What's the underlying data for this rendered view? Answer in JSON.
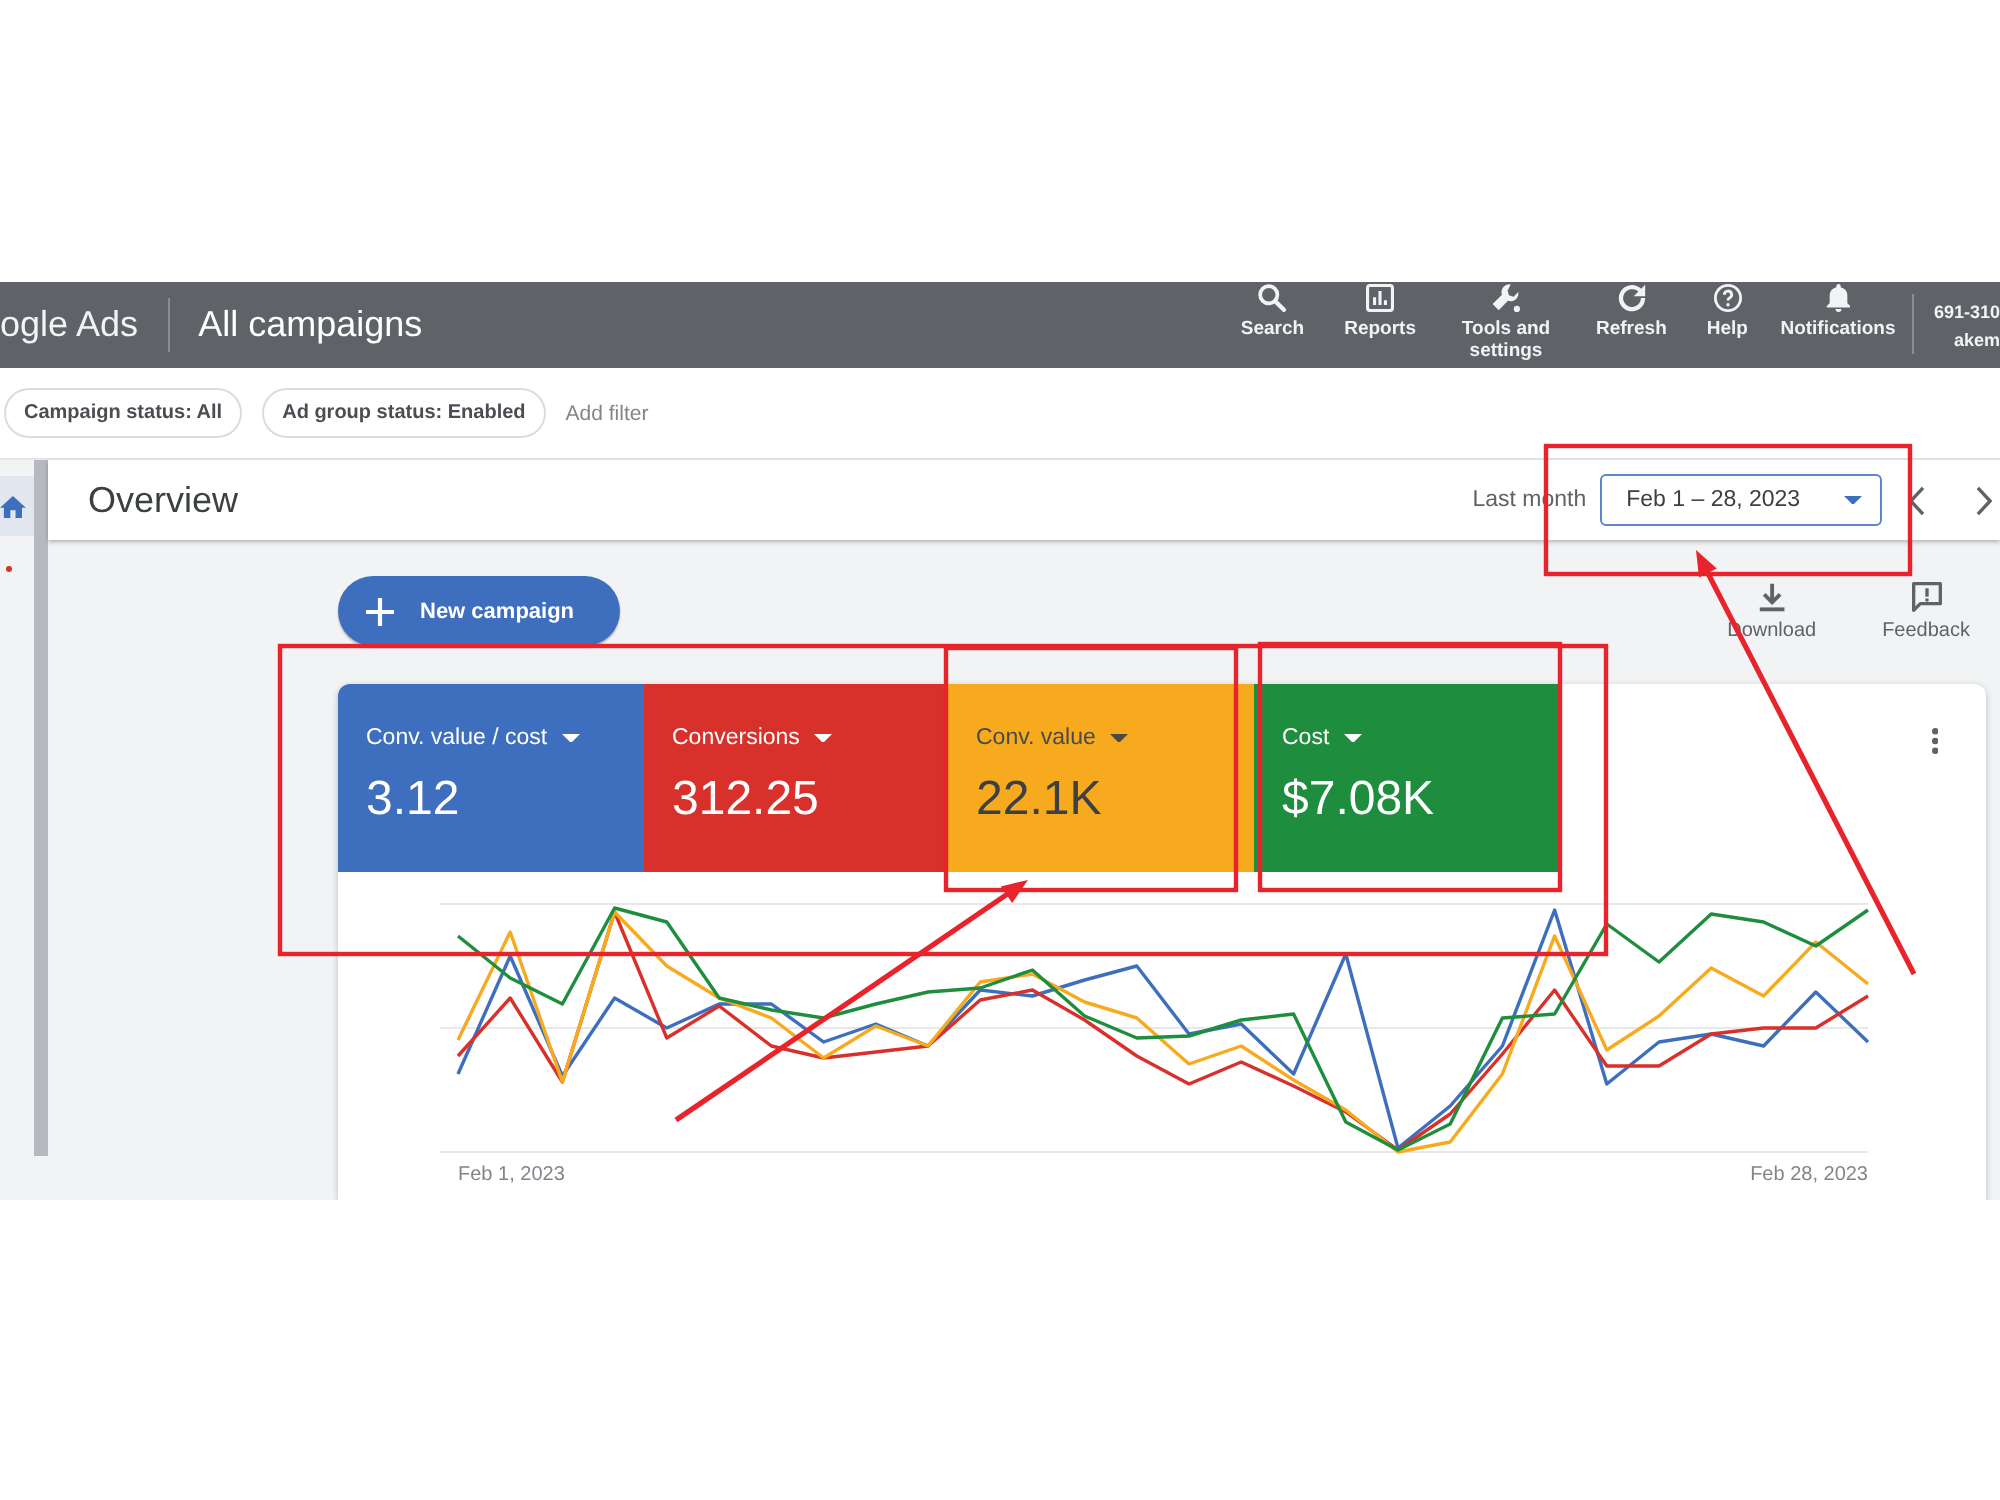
{
  "app_bar": {
    "product": "ogle Ads",
    "title": "All campaigns",
    "actions": [
      {
        "kind": "search",
        "label": "Search"
      },
      {
        "kind": "reports",
        "label": "Reports"
      },
      {
        "kind": "tools",
        "label": "Tools and settings"
      },
      {
        "kind": "refresh",
        "label": "Refresh"
      },
      {
        "kind": "help",
        "label": "Help"
      },
      {
        "kind": "notifications",
        "label": "Notifications"
      }
    ],
    "account": {
      "id": "691-310",
      "name": "akem"
    }
  },
  "filter_bar": {
    "chips": [
      {
        "label": "Campaign status: All"
      },
      {
        "label": "Ad group status: Enabled"
      }
    ],
    "add_filter": "Add filter"
  },
  "sidebar": {
    "items": [
      {
        "kind": "home",
        "selected": true
      },
      {
        "kind": "dot",
        "selected": false
      }
    ]
  },
  "overview": {
    "title": "Overview",
    "range_label": "Last month",
    "date_range": "Feb 1 – 28, 2023"
  },
  "toolbar": {
    "new_campaign": "New campaign",
    "tools": [
      {
        "kind": "download",
        "label": "Download"
      },
      {
        "kind": "feedback",
        "label": "Feedback"
      }
    ]
  },
  "metrics": [
    {
      "label": "Conv. value / cost",
      "value": "3.12",
      "color": "#3e6fbe",
      "selected": true
    },
    {
      "label": "Conversions",
      "value": "312.25",
      "color": "#d8302a",
      "selected": true
    },
    {
      "label": "Conv. value",
      "value": "22.1K",
      "color": "#f8aa1e",
      "selected": true
    },
    {
      "label": "Cost",
      "value": "$7.08K",
      "color": "#1e8e3e",
      "selected": true
    }
  ],
  "chart": {
    "x_start": "Feb 1, 2023",
    "x_end": "Feb 28, 2023"
  },
  "annotations": [
    {
      "kind": "box"
    },
    {
      "kind": "box"
    },
    {
      "kind": "box"
    },
    {
      "kind": "box"
    },
    {
      "kind": "arrow"
    },
    {
      "kind": "arrow"
    }
  ]
}
